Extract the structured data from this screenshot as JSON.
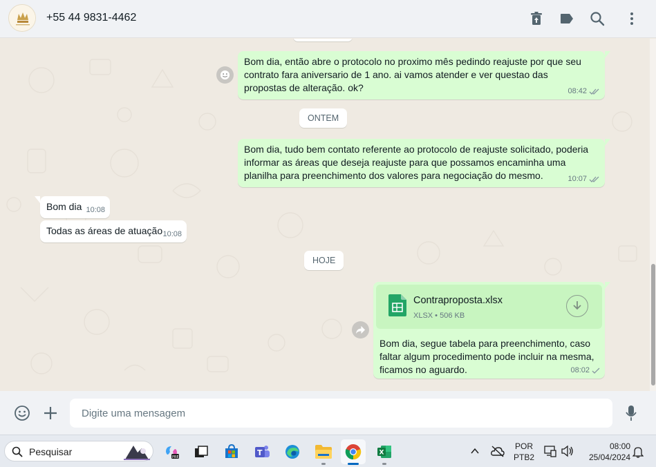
{
  "header": {
    "contact": "+55 44 9831-4462",
    "icons": [
      "delete-icon",
      "label-icon",
      "search-icon",
      "menu-icon"
    ]
  },
  "chat": {
    "messages": [
      {
        "dir": "out",
        "text": "Bom dia, então abre o protocolo no proximo mês pedindo reajuste por que seu contrato fara aniversario de 1 ano. ai vamos atender e ver questao das propostas de alteração. ok?",
        "time": "08:42",
        "status": "read"
      },
      {
        "dir": "out",
        "text": "Bom dia, tudo bem contato referente ao protocolo de reajuste solicitado, poderia informar as áreas que deseja reajuste para que possamos encaminha uma planilha para preenchimento dos valores para negociação do mesmo.",
        "time": "10:07",
        "status": "read"
      },
      {
        "dir": "in",
        "text": "Bom dia",
        "time": "10:08"
      },
      {
        "dir": "in",
        "text": "Todas as áreas de atuação",
        "time": "10:08"
      },
      {
        "dir": "out",
        "file": {
          "name": "Contraproposta.xlsx",
          "info": "XLSX • 506 KB"
        },
        "text": "Bom dia, segue tabela para preenchimento, caso faltar algum procedimento pode incluir na mesma, ficamos no aguardo.",
        "time": "08:02",
        "status": "sent"
      }
    ],
    "date_chips": [
      "ONTEM",
      "HOJE"
    ]
  },
  "composer": {
    "placeholder": "Digite uma mensagem"
  },
  "taskbar": {
    "search_label": "Pesquisar",
    "language_line1": "POR",
    "language_line2": "PTB2",
    "time": "08:00",
    "date": "25/04/2024"
  },
  "colors": {
    "outgoing_bubble": "#d9fdd3",
    "incoming_bubble": "#ffffff",
    "chat_background": "#efeae2",
    "read_ticks": "#8696a0"
  }
}
